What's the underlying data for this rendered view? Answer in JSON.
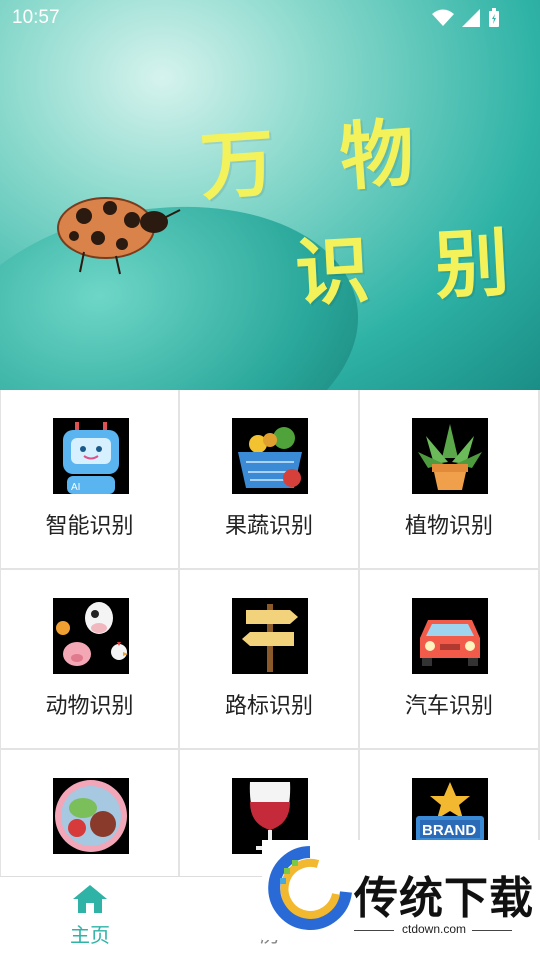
{
  "status_bar": {
    "time": "10:57"
  },
  "banner": {
    "line1": "万 物",
    "line2": "识 别"
  },
  "grid": {
    "items": [
      {
        "label": "智能识别",
        "icon": "ai-robot-icon"
      },
      {
        "label": "果蔬识别",
        "icon": "fruit-basket-icon"
      },
      {
        "label": "植物识别",
        "icon": "potted-plant-icon"
      },
      {
        "label": "动物识别",
        "icon": "farm-animals-icon"
      },
      {
        "label": "路标识别",
        "icon": "signpost-icon"
      },
      {
        "label": "汽车识别",
        "icon": "car-icon"
      },
      {
        "label": "",
        "icon": "food-plate-icon"
      },
      {
        "label": "",
        "icon": "wine-glass-icon"
      },
      {
        "label": "",
        "icon": "brand-icon"
      }
    ],
    "brand_text": "BRAND",
    "robot_badge": "AI"
  },
  "tabbar": {
    "home": "主页",
    "second": "历"
  },
  "watermark": {
    "text": "传统下载",
    "url": "ctdown.com"
  },
  "colors": {
    "accent": "#2fb3a6",
    "title_yellow": "#f4f25a"
  }
}
